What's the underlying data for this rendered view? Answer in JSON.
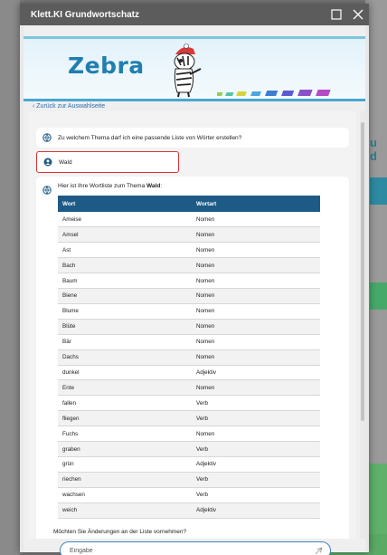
{
  "window": {
    "title": "Klett.KI Grundwortschatz"
  },
  "banner": {
    "logo_text": "Zebra"
  },
  "nav": {
    "back_label": "‹ Zurück zur Auswahlseite"
  },
  "chat": {
    "question": "Zu welchem Thema darf ich eine passende Liste von Wörter erstellen?",
    "user_message": "Wald",
    "answer_intro": "Hier ist Ihre Wortliste zum Thema ",
    "answer_topic": "Wald",
    "answer_colon": ":",
    "table": {
      "headers": [
        "Wort",
        "Wortart"
      ],
      "rows": [
        [
          "Ameise",
          "Nomen"
        ],
        [
          "Amsel",
          "Nomen"
        ],
        [
          "Ast",
          "Nomen"
        ],
        [
          "Bach",
          "Nomen"
        ],
        [
          "Baum",
          "Nomen"
        ],
        [
          "Biene",
          "Nomen"
        ],
        [
          "Blume",
          "Nomen"
        ],
        [
          "Blüte",
          "Nomen"
        ],
        [
          "Bär",
          "Nomen"
        ],
        [
          "Dachs",
          "Nomen"
        ],
        [
          "dunkel",
          "Adjektiv"
        ],
        [
          "Ente",
          "Nomen"
        ],
        [
          "fallen",
          "Verb"
        ],
        [
          "fliegen",
          "Verb"
        ],
        [
          "Fuchs",
          "Nomen"
        ],
        [
          "graben",
          "Verb"
        ],
        [
          "grün",
          "Adjektiv"
        ],
        [
          "riechen",
          "Verb"
        ],
        [
          "wachsen",
          "Verb"
        ],
        [
          "weich",
          "Adjektiv"
        ]
      ]
    },
    "followup": "Möchten Sie Änderungen an der Liste vornehmen?"
  },
  "input": {
    "placeholder": "Eingabe",
    "value": ""
  },
  "icons": {
    "maximize": "maximize-icon",
    "close": "close-icon",
    "bot_avatar": "globe-bot-icon",
    "user_avatar": "user-icon",
    "send": "send-icon"
  },
  "colors": {
    "titlebar": "#5c5c5c",
    "table_header": "#1e5a86",
    "logo": "#1f7fae",
    "highlight_border": "#d93434",
    "input_border": "#3e84c0"
  }
}
